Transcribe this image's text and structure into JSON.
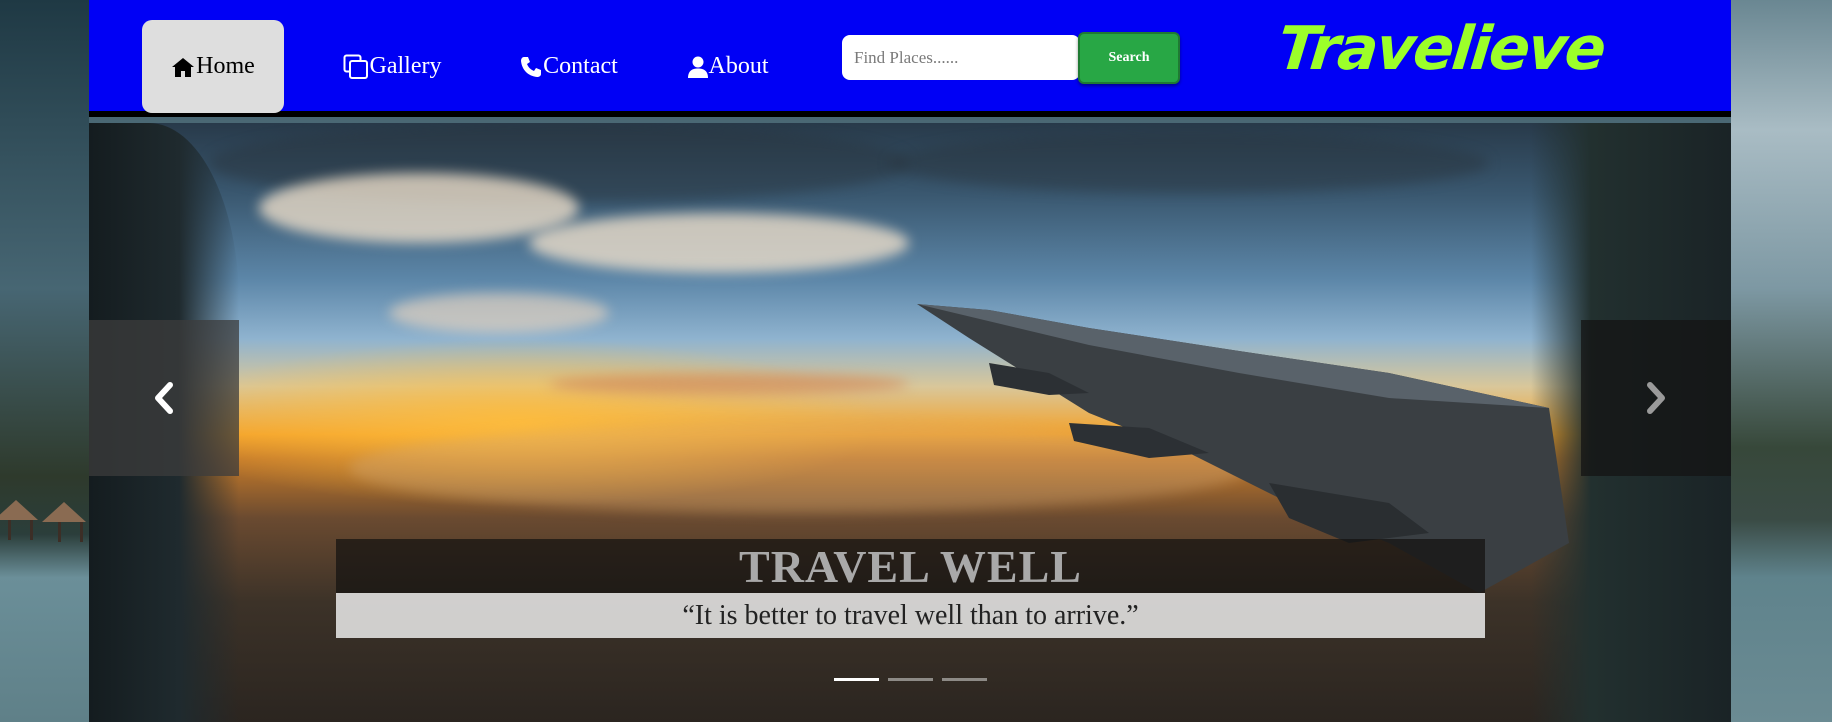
{
  "nav": {
    "items": [
      {
        "label": "Home",
        "icon": "home-icon",
        "active": true
      },
      {
        "label": "Gallery",
        "icon": "gallery-icon",
        "active": false
      },
      {
        "label": "Contact",
        "icon": "phone-icon",
        "active": false
      },
      {
        "label": "About",
        "icon": "user-icon",
        "active": false
      }
    ],
    "search_placeholder": "Find Places......",
    "search_value": "",
    "search_button_label": "Search",
    "brand": "Travelieve",
    "colors": {
      "navbar": "#0000f5",
      "brand": "#9cff29",
      "search_button": "#28a745",
      "active_item": "#dedede"
    }
  },
  "carousel": {
    "title": "TRAVEL WELL",
    "quote": "“It is better to travel well than to arrive.”",
    "slide_count": 3,
    "active_slide": 1,
    "prev_icon": "chevron-left-icon",
    "next_icon": "chevron-right-icon"
  }
}
